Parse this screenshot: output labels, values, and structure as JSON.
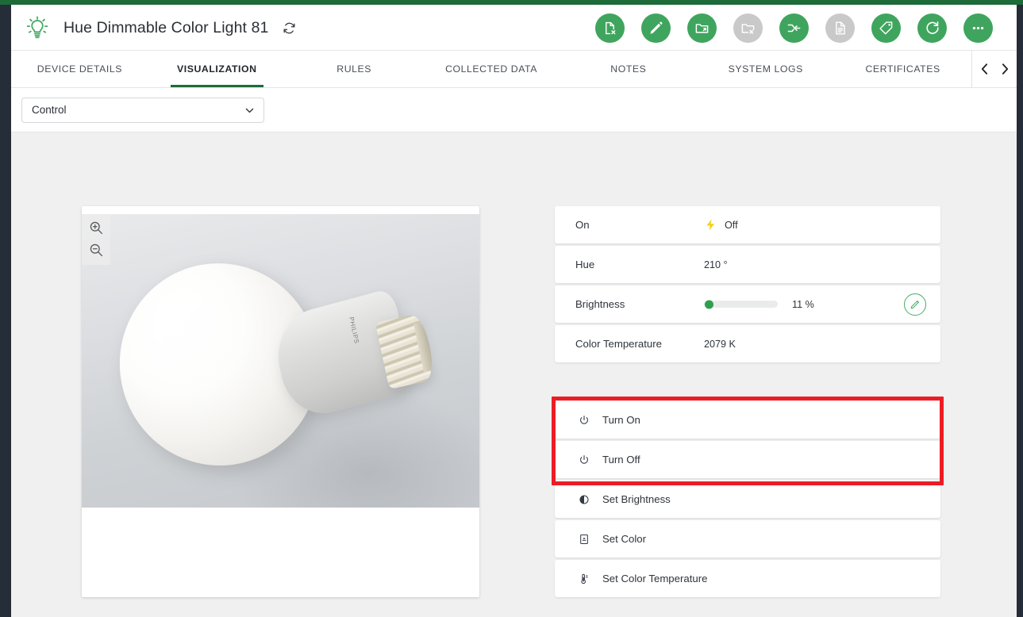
{
  "theme": {
    "accent_green": "#3fa55e",
    "dark_green": "#1d6b38",
    "rail_dark": "#252d38",
    "highlight_red": "#ed1c24",
    "page_bg": "#f0f0f0"
  },
  "header": {
    "device_icon": "lightbulb-icon",
    "title": "Hue Dimmable Color Light 81",
    "refresh_icon": "refresh-icon",
    "actions": [
      {
        "name": "delete-device-button",
        "icon": "file-delete-icon",
        "enabled": true
      },
      {
        "name": "edit-device-button",
        "icon": "pencil-icon",
        "enabled": true
      },
      {
        "name": "move-device-button",
        "icon": "folder-move-icon",
        "enabled": true
      },
      {
        "name": "delete-folder-button",
        "icon": "folder-delete-icon",
        "enabled": false
      },
      {
        "name": "connect-device-button",
        "icon": "arrow-merge-icon",
        "enabled": true
      },
      {
        "name": "document-button",
        "icon": "document-icon",
        "enabled": false
      },
      {
        "name": "tag-button",
        "icon": "tag-icon",
        "enabled": true
      },
      {
        "name": "refresh-button",
        "icon": "refresh-circle-icon",
        "enabled": true
      },
      {
        "name": "more-options-button",
        "icon": "ellipsis-icon",
        "enabled": true
      }
    ]
  },
  "tabs": {
    "items": [
      {
        "label": "DEVICE DETAILS",
        "active": false
      },
      {
        "label": "VISUALIZATION",
        "active": true
      },
      {
        "label": "RULES",
        "active": false
      },
      {
        "label": "COLLECTED DATA",
        "active": false
      },
      {
        "label": "NOTES",
        "active": false
      },
      {
        "label": "SYSTEM LOGS",
        "active": false
      },
      {
        "label": "CERTIFICATES",
        "active": false
      }
    ],
    "prev_icon": "chevron-left-icon",
    "next_icon": "chevron-right-icon",
    "prev_glyph": "‹",
    "next_glyph": "›"
  },
  "filter": {
    "select_value": "Control",
    "select_icon": "chevron-down-icon"
  },
  "image_panel": {
    "zoom_in_icon": "zoom-in-icon",
    "zoom_out_icon": "zoom-out-icon",
    "photo_alt": "philips-led-bulb-photo",
    "brand_text": "PHILIPS"
  },
  "properties": [
    {
      "label": "On",
      "value": "Off",
      "icon": "flash-icon",
      "type": "state"
    },
    {
      "label": "Hue",
      "value": "210 °",
      "type": "text"
    },
    {
      "label": "Brightness",
      "value": "11 %",
      "percent": 11,
      "type": "slider",
      "edit_icon": "pencil-icon"
    },
    {
      "label": "Color Temperature",
      "value": "2079 K",
      "type": "text"
    }
  ],
  "actions": [
    {
      "label": "Turn On",
      "icon": "power-icon",
      "highlighted": true
    },
    {
      "label": "Turn Off",
      "icon": "power-icon",
      "highlighted": true
    },
    {
      "label": "Set Brightness",
      "icon": "brightness-half-icon",
      "highlighted": false
    },
    {
      "label": "Set Color",
      "icon": "color-swatch-icon",
      "highlighted": false
    },
    {
      "label": "Set Color Temperature",
      "icon": "thermometer-icon",
      "highlighted": false
    }
  ],
  "highlight": {
    "name": "red-annotation-box",
    "color": "#ed1c24"
  }
}
